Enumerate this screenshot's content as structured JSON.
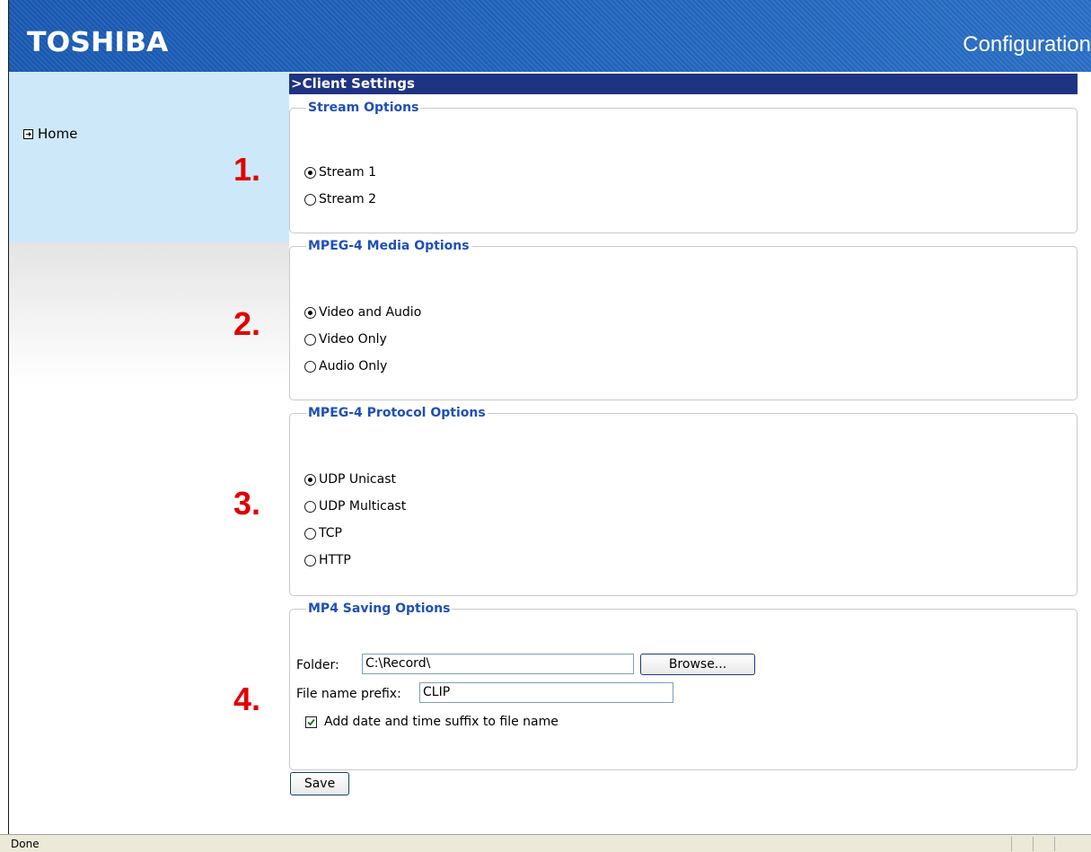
{
  "header": {
    "brand": "TOSHIBA",
    "title": "Configuration"
  },
  "sidebar": {
    "home_label": "Home"
  },
  "section": {
    "title": ">Client Settings"
  },
  "markers": [
    "1.",
    "2.",
    "3.",
    "4."
  ],
  "stream_options": {
    "legend": "Stream Options",
    "options": [
      {
        "label": "Stream 1",
        "selected": true
      },
      {
        "label": "Stream 2",
        "selected": false
      }
    ]
  },
  "media_options": {
    "legend": "MPEG-4 Media Options",
    "options": [
      {
        "label": "Video and Audio",
        "selected": true
      },
      {
        "label": "Video Only",
        "selected": false
      },
      {
        "label": "Audio Only",
        "selected": false
      }
    ]
  },
  "protocol_options": {
    "legend": "MPEG-4 Protocol Options",
    "options": [
      {
        "label": "UDP Unicast",
        "selected": true
      },
      {
        "label": "UDP Multicast",
        "selected": false
      },
      {
        "label": "TCP",
        "selected": false
      },
      {
        "label": "HTTP",
        "selected": false
      }
    ]
  },
  "saving_options": {
    "legend": "MP4 Saving Options",
    "folder_label": "Folder:",
    "folder_value": "C:\\Record\\",
    "browse_label": "Browse...",
    "prefix_label": "File name prefix:",
    "prefix_value": "CLIP",
    "suffix_label": "Add date and time suffix to file name",
    "suffix_checked": true
  },
  "save_label": "Save",
  "status": {
    "text": "Done"
  },
  "colors": {
    "header_blue": "#1a5fb8",
    "section_bar": "#1f3383",
    "legend_text": "#1f4fb8",
    "marker_red": "#e00000",
    "sidebar_bg": "#cde8f8"
  }
}
